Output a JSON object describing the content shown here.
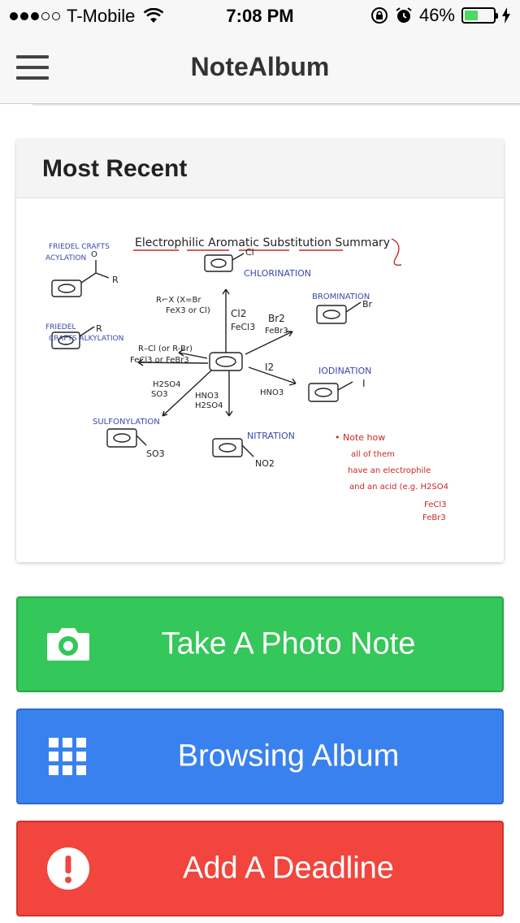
{
  "status_bar": {
    "carrier": "T-Mobile",
    "time": "7:08 PM",
    "battery": "46%",
    "battery_level": 0.46,
    "signal_bars": 3
  },
  "navbar": {
    "title": "NoteAlbum"
  },
  "recent_card": {
    "heading": "Most Recent",
    "note_text": {
      "title": "Electrophilic Aromatic Substitution Summary",
      "friedel_acyl_1": "FRIEDEL CRAFTS",
      "friedel_acyl_2": "ACYLATION",
      "friedel_alk_1": "FRIEDEL",
      "friedel_alk_2": "CRAFTS ALKYLATION",
      "chlorination": "CHLORINATION",
      "bromination": "BROMINATION",
      "iodination": "IODINATION",
      "sulfonylation": "SULFONYLATION",
      "nitration": "NITRATION",
      "note_1": "• Note how",
      "note_2": "all of them",
      "note_3": "have an electrophile",
      "note_4": "and an acid (e.g. H2SO4",
      "note_5": "FeCl3",
      "note_6": "FeBr3",
      "r_group": "R",
      "o_atom": "O",
      "cl_sub": "Cl",
      "br_sub": "Br",
      "i_sub": "I",
      "so3_sub": "SO3",
      "no2_sub": "NO2",
      "acyl_reagent_1": "R⌐X (X=Br",
      "acyl_reagent_2": "FeX3  or Cl)",
      "alk_reagent_1": "R–Cl (or R-Br)",
      "alk_reagent_2": "FeCl3 or FeBr3",
      "cl_reagent_1": "Cl2",
      "cl_reagent_2": "FeCl3",
      "br_reagent_1": "Br2",
      "br_reagent_2": "FeBr3",
      "i_reagent": "I2",
      "hno3_right": "HNO3",
      "so_reagent_1": "H2SO4",
      "so_reagent_2": "SO3",
      "no_reagent_1": "HNO3",
      "no_reagent_2": "H2SO4"
    }
  },
  "actions": [
    {
      "label": "Take A Photo Note",
      "icon": "camera-icon",
      "color": "#34c759"
    },
    {
      "label": "Browsing Album",
      "icon": "grid-icon",
      "color": "#3a81f0"
    },
    {
      "label": "Add A Deadline",
      "icon": "alert-icon",
      "color": "#f1453d"
    }
  ]
}
